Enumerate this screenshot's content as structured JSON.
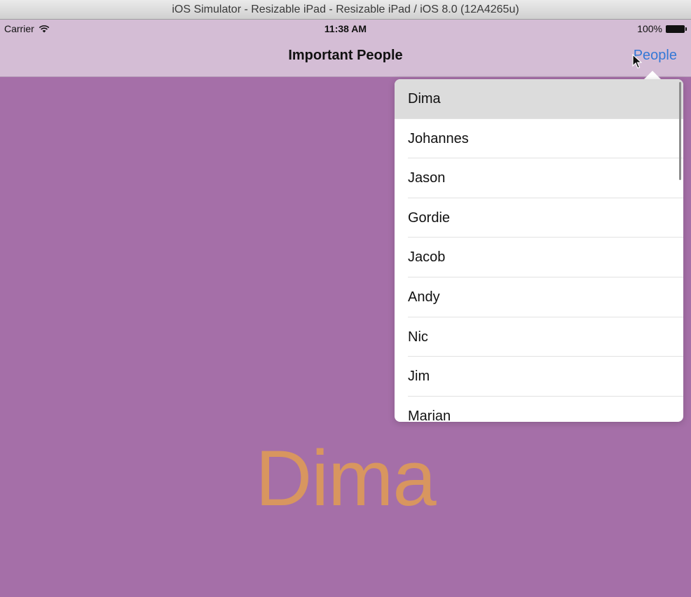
{
  "window": {
    "title": "iOS Simulator - Resizable iPad - Resizable iPad / iOS 8.0 (12A4265u)"
  },
  "status_bar": {
    "carrier": "Carrier",
    "time": "11:38 AM",
    "battery": "100%",
    "icons": [
      "wifi-icon",
      "battery-icon"
    ]
  },
  "nav_bar": {
    "title": "Important People",
    "right_button": "People"
  },
  "popover": {
    "selected": "Dima",
    "items": [
      {
        "label": "Dima"
      },
      {
        "label": "Johannes"
      },
      {
        "label": "Jason"
      },
      {
        "label": "Gordie"
      },
      {
        "label": "Jacob"
      },
      {
        "label": "Andy"
      },
      {
        "label": "Nic"
      },
      {
        "label": "Jim"
      },
      {
        "label": "Marian"
      }
    ]
  },
  "main": {
    "name_label": "Dima"
  },
  "colors": {
    "background": "#a56fa8",
    "nav_bar": "#d4bdd5",
    "accent": "#3478d6",
    "name_label": "#d8965f",
    "selected_row": "#dcdcdc"
  }
}
